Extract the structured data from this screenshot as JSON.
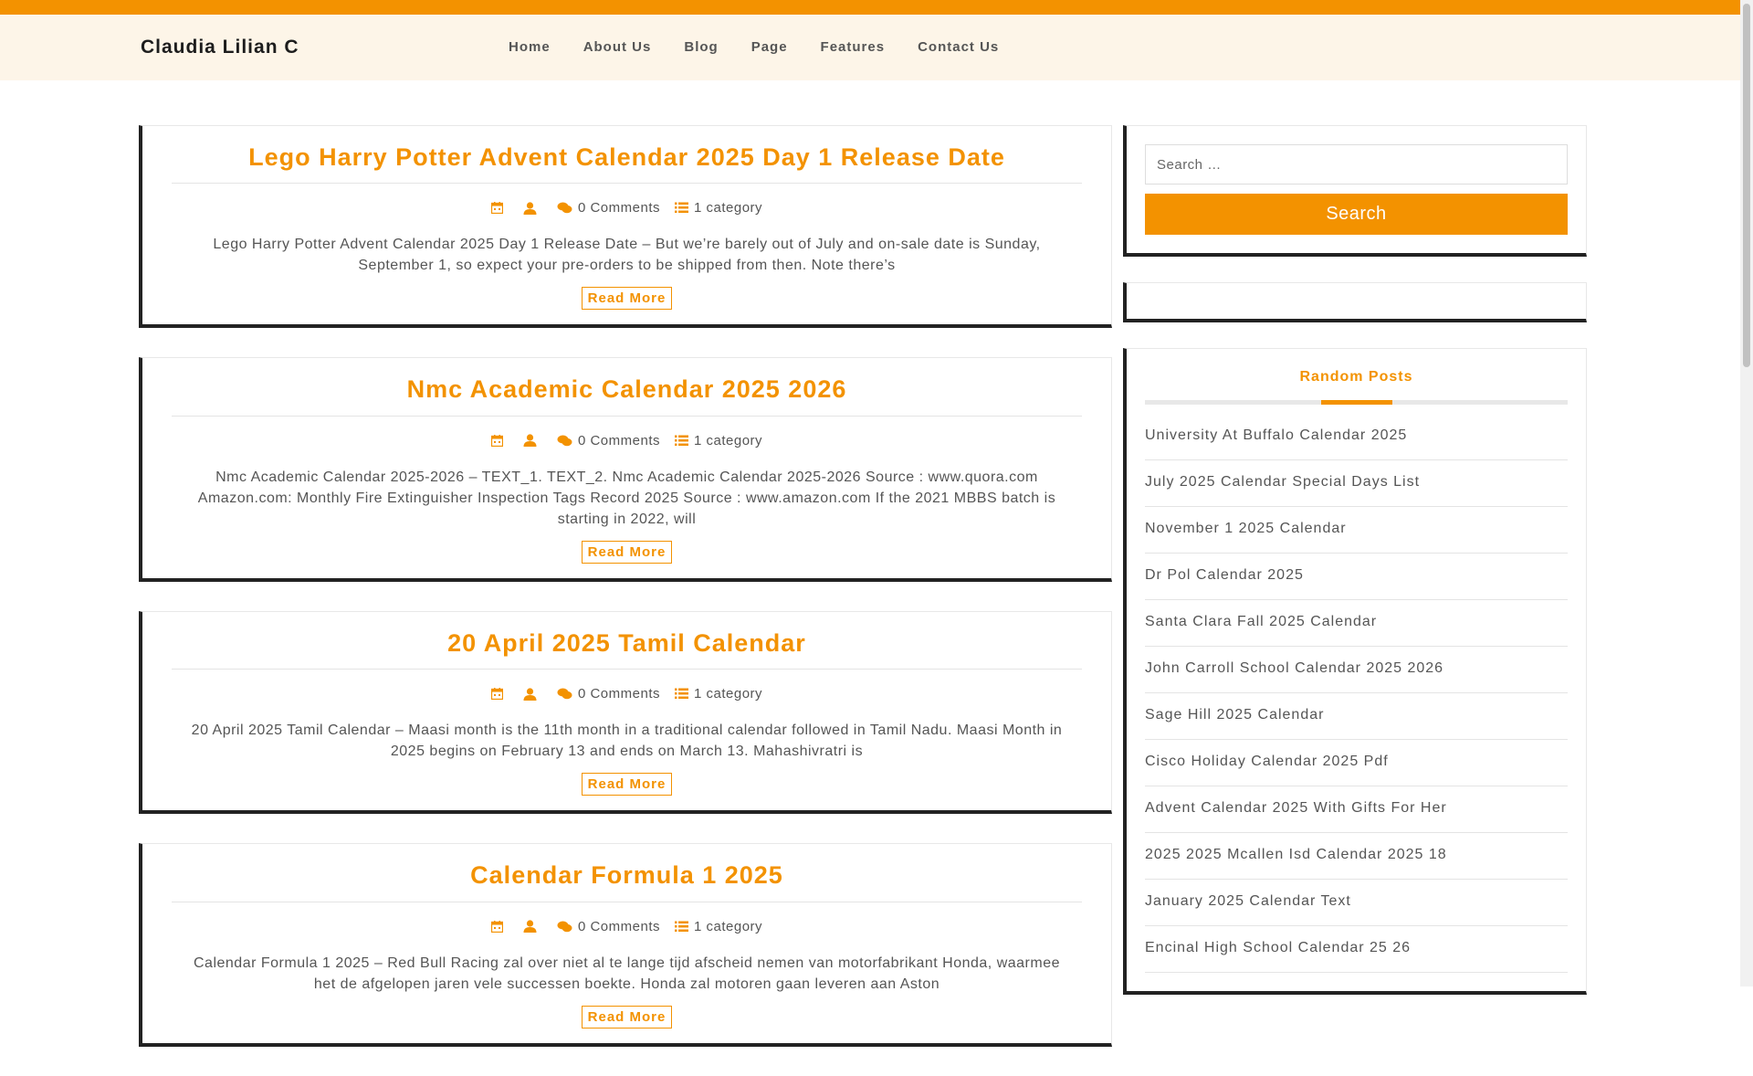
{
  "site": {
    "title": "Claudia Lilian C"
  },
  "nav": [
    "Home",
    "About Us",
    "Blog",
    "Page",
    "Features",
    "Contact Us"
  ],
  "posts": [
    {
      "title": "Lego Harry Potter Advent Calendar 2025 Day 1 Release Date",
      "comments": "0 Comments",
      "category": "1 category",
      "excerpt": "Lego Harry Potter Advent Calendar 2025 Day 1 Release Date – But we’re barely out of July and on-sale date is Sunday, September 1, so expect your pre-orders to be shipped from then. Note there’s",
      "read_more": "Read More"
    },
    {
      "title": "Nmc Academic Calendar 2025 2026",
      "comments": "0 Comments",
      "category": "1 category",
      "excerpt": "Nmc Academic Calendar 2025-2026 – TEXT_1. TEXT_2. Nmc Academic Calendar 2025-2026 Source : www.quora.com Amazon.com: Monthly Fire Extinguisher Inspection Tags Record 2025 Source : www.amazon.com If the 2021 MBBS batch is starting in 2022, will",
      "read_more": "Read More"
    },
    {
      "title": "20 April 2025 Tamil Calendar",
      "comments": "0 Comments",
      "category": "1 category",
      "excerpt": "20 April 2025 Tamil Calendar – Maasi month is the 11th month in a traditional calendar followed in Tamil Nadu. Maasi Month in 2025 begins on February 13 and ends on March 13. Mahashivratri is",
      "read_more": "Read More"
    },
    {
      "title": "Calendar Formula 1 2025",
      "comments": "0 Comments",
      "category": "1 category",
      "excerpt": "Calendar Formula 1 2025 – Red Bull Racing zal over niet al te lange tijd afscheid nemen van motorfabrikant Honda, waarmee het de afgelopen jaren vele successen boekte. Honda zal motoren gaan leveren aan Aston",
      "read_more": "Read More"
    }
  ],
  "search": {
    "placeholder": "Search …",
    "button": "Search"
  },
  "random_posts": {
    "title": "Random Posts",
    "items": [
      "University At Buffalo Calendar 2025",
      "July 2025 Calendar Special Days List",
      "November 1 2025 Calendar",
      "Dr Pol Calendar 2025",
      "Santa Clara Fall 2025 Calendar",
      "John Carroll School Calendar 2025 2026",
      "Sage Hill 2025 Calendar",
      "Cisco Holiday Calendar 2025 Pdf",
      "Advent Calendar 2025 With Gifts For Her",
      "2025 2025 Mcallen Isd Calendar 2025 18",
      "January 2025 Calendar Text",
      "Encinal High School Calendar 25 26"
    ]
  },
  "colors": {
    "accent": "#f39200",
    "header_bg": "#fdf5e8",
    "border_dark": "#222222"
  },
  "icons": [
    "calendar-icon",
    "user-icon",
    "comments-icon",
    "list-icon"
  ]
}
